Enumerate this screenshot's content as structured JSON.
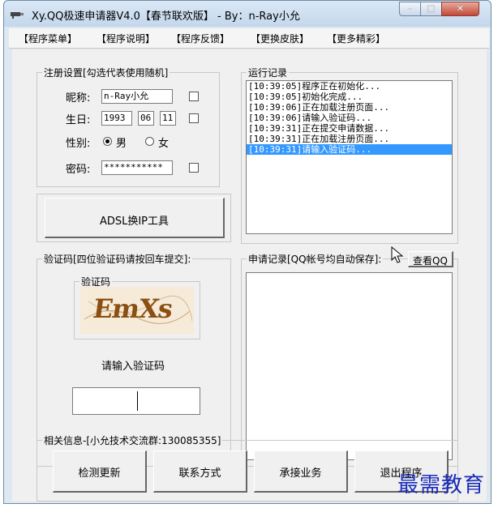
{
  "window": {
    "title": "Xy.QQ极速申请器V4.0【春节联欢版】 - By：n-Ray小允",
    "controls": {
      "minimize": "–",
      "maximize": "□",
      "close": "✕"
    }
  },
  "menu": [
    "【程序菜单】",
    "【程序说明】",
    "【程序反馈】",
    "【更换皮肤】",
    "【更多精彩】"
  ],
  "register": {
    "legend": "注册设置[勾选代表使用随机]",
    "nickname_label": "昵称:",
    "nickname_value": "n-Ray小允",
    "birthday_label": "生日:",
    "birth_year": "1993",
    "birth_month": "06",
    "birth_day": "11",
    "gender_label": "性别:",
    "gender_male": "男",
    "gender_female": "女",
    "password_label": "密码:",
    "password_value": "***********"
  },
  "adsl_button": "ADSL换IP工具",
  "log": {
    "legend": "运行记录",
    "lines": [
      "[10:39:05]程序正在初始化...",
      "[10:39:05]初始化完成...",
      "[10:39:06]正在加载注册页面...",
      "[10:39:06]请输入验证码...",
      "[10:39:31]正在提交申请数据...",
      "[10:39:31]正在加载注册页面...",
      "[10:39:31]请输入验证码..."
    ],
    "selected_index": 6
  },
  "captcha": {
    "legend": "验证码[四位验证码请按回车提交]:",
    "inner_legend": "验证码",
    "image_text": "EmXs",
    "prompt": "请输入验证码",
    "input_value": ""
  },
  "records": {
    "legend": "申请记录[QQ帐号均自动保存]:",
    "view_button": "查看QQ"
  },
  "info": {
    "legend": "相关信息-[小允技术交流群:130085355]",
    "buttons": [
      "检测更新",
      "联系方式",
      "承接业务",
      "退出程序"
    ]
  },
  "watermark": "最需教育",
  "colors": {
    "selection": "#3399ff",
    "watermark": "#1a2bb8",
    "captcha_text": "#8a4f12"
  }
}
